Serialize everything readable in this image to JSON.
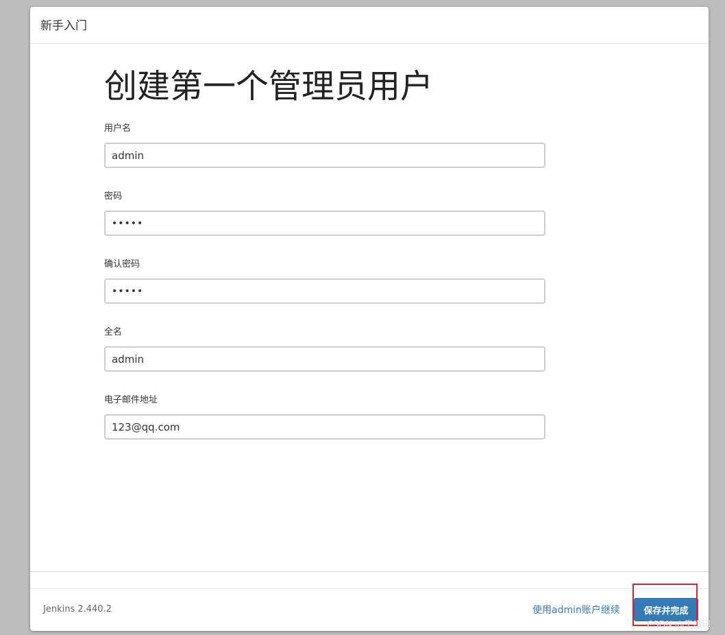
{
  "dialog": {
    "title": "新手入门",
    "heading": "创建第一个管理员用户"
  },
  "form": {
    "username": {
      "label": "用户名",
      "value": "admin"
    },
    "password": {
      "label": "密码",
      "value": "•••••"
    },
    "confirm_password": {
      "label": "确认密码",
      "value": "•••••"
    },
    "fullname": {
      "label": "全名",
      "value": "admin"
    },
    "email": {
      "label": "电子邮件地址",
      "value": "123@qq.com"
    }
  },
  "footer": {
    "version": "Jenkins 2.440.2",
    "skip_label": "使用admin账户继续",
    "save_label": "保存并完成"
  },
  "colors": {
    "primary": "#337ab7",
    "highlight": "#e0202a"
  },
  "watermark": "CSDN @王德印"
}
